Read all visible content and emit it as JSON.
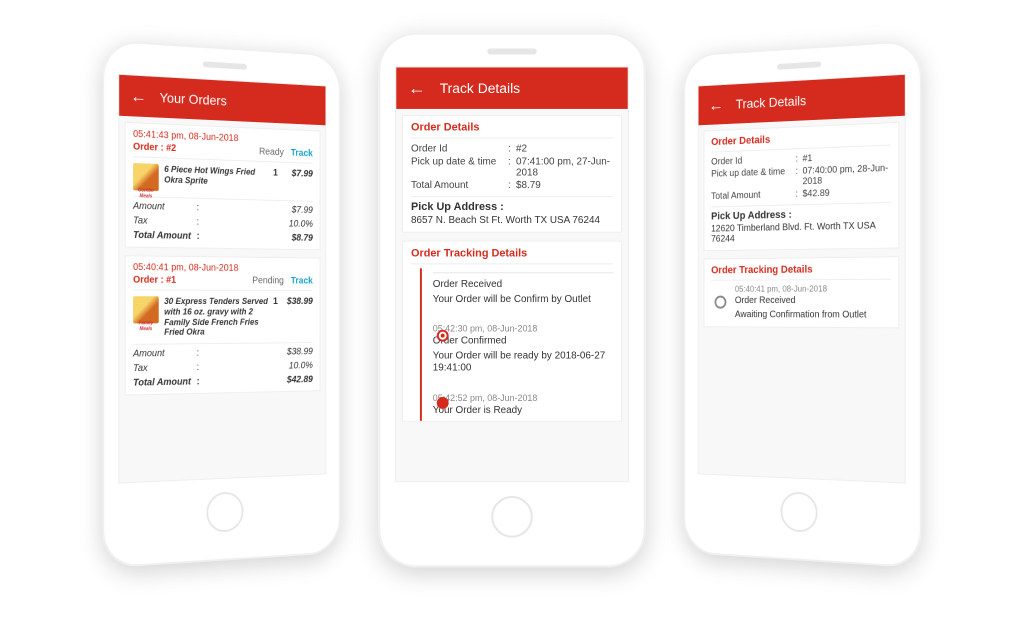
{
  "colors": {
    "accent": "#d52b1e",
    "link": "#1aa3c7"
  },
  "phone1": {
    "title": "Your Orders",
    "orders": [
      {
        "timestamp": "05:41:43 pm, 08-Jun-2018",
        "order_label": "Order :",
        "order_no": "#2",
        "status": "Ready",
        "track_label": "Track",
        "thumb_caption": "Combo Meals",
        "item_name": "6 Piece Hot Wings Fried Okra Sprite",
        "qty": "1",
        "price": "$7.99",
        "amount_label": "Amount",
        "amount": "$7.99",
        "tax_label": "Tax",
        "tax": "10.0%",
        "total_label": "Total Amount",
        "total": "$8.79"
      },
      {
        "timestamp": "05:40:41 pm, 08-Jun-2018",
        "order_label": "Order :",
        "order_no": "#1",
        "status": "Pending",
        "track_label": "Track",
        "thumb_caption": "Family Meals",
        "item_name": "30 Express Tenders Served with 16 oz. gravy with 2 Family Side French Fries Fried Okra",
        "qty": "1",
        "price": "$38.99",
        "amount_label": "Amount",
        "amount": "$38.99",
        "tax_label": "Tax",
        "tax": "10.0%",
        "total_label": "Total Amount",
        "total": "$42.89"
      }
    ]
  },
  "phone2": {
    "title": "Track Details",
    "section_order": "Order Details",
    "kv": {
      "order_id_label": "Order Id",
      "order_id": "#2",
      "pickup_label": "Pick up date & time",
      "pickup": "07:41:00 pm, 27-Jun-2018",
      "total_label": "Total Amount",
      "total": "$8.79"
    },
    "pickup_head": "Pick Up Address  :",
    "pickup_addr": "8657 N. Beach St Ft.  Worth TX USA 76244",
    "section_track": "Order Tracking Details",
    "steps": [
      {
        "ts": "",
        "line1": "Order Received",
        "line2": "Your Order will be Confirm by Outlet"
      },
      {
        "ts": "05:42:30 pm, 08-Jun-2018",
        "line1": "Order Confirmed",
        "line2": " Your Order will be ready by 2018-06-27 19:41:00"
      },
      {
        "ts": "05:42:52 pm, 08-Jun-2018",
        "line1": "Your Order is Ready",
        "line2": ""
      }
    ]
  },
  "phone3": {
    "title": "Track Details",
    "section_order": "Order Details",
    "kv": {
      "order_id_label": "Order Id",
      "order_id": "#1",
      "pickup_label": "Pick up date & time",
      "pickup": "07:40:00 pm, 28-Jun-2018",
      "total_label": "Total Amount",
      "total": "$42.89"
    },
    "pickup_head": "Pick Up Address  :",
    "pickup_addr": "12620 Timberland Blvd. Ft. Worth TX USA 76244",
    "section_track": "Order Tracking Details",
    "step": {
      "ts": "05:40:41 pm, 08-Jun-2018",
      "line1": "Order Received",
      "line2": "Awaiting Confirmation from Outlet"
    }
  }
}
